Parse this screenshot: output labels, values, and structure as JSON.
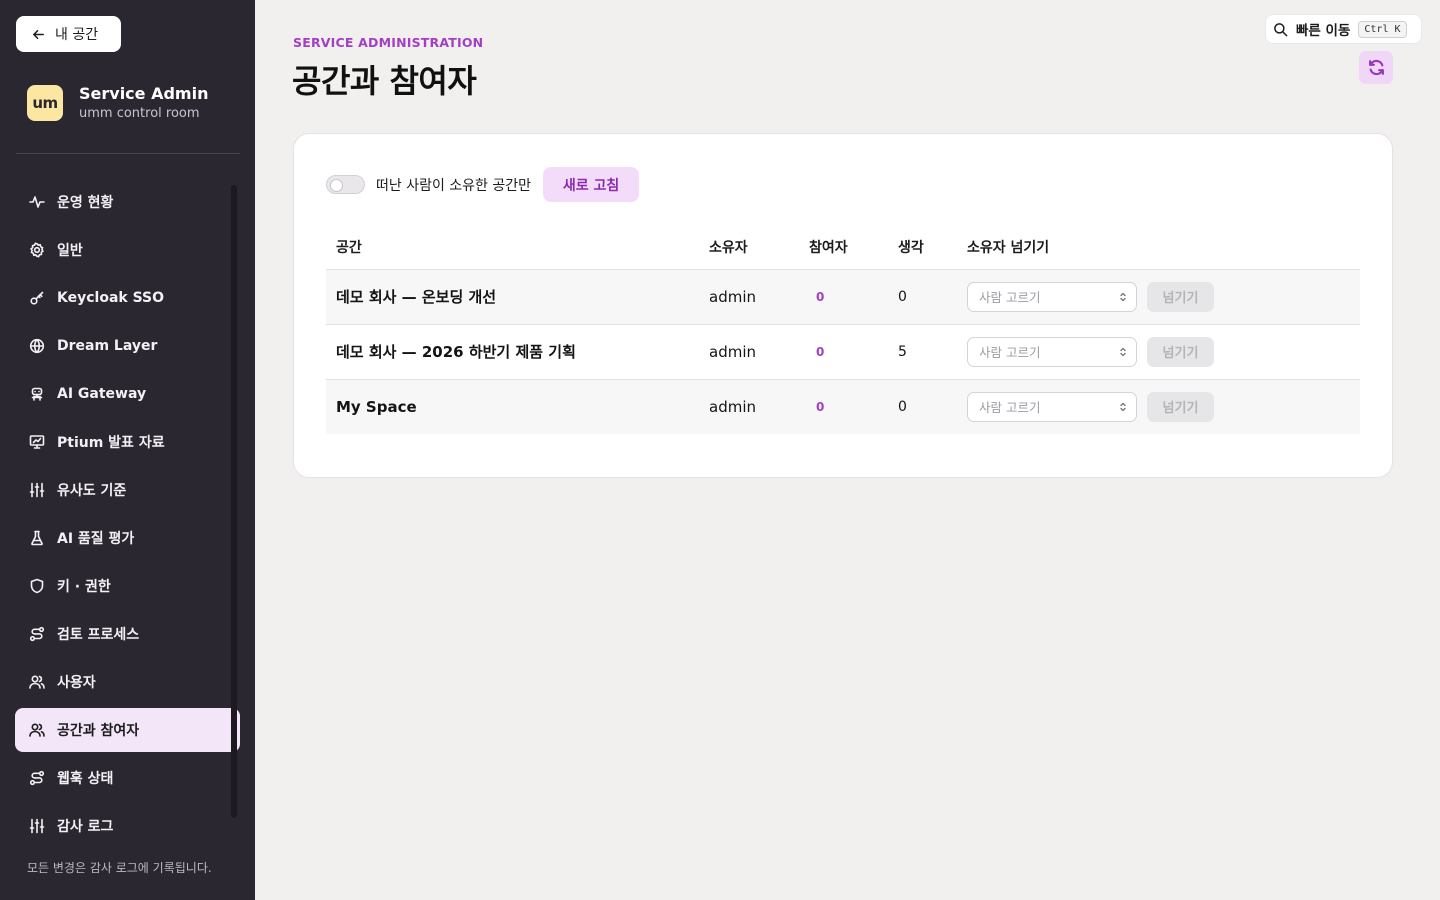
{
  "sidebar": {
    "back_label": "내 공간",
    "brand_logo": "um",
    "brand_title": "Service Admin",
    "brand_subtitle": "umm control room",
    "items": [
      {
        "label": "운영 현황",
        "icon": "activity-icon"
      },
      {
        "label": "일반",
        "icon": "gear-icon"
      },
      {
        "label": "Keycloak SSO",
        "icon": "key-icon"
      },
      {
        "label": "Dream Layer",
        "icon": "layers-icon"
      },
      {
        "label": "AI Gateway",
        "icon": "bot-icon"
      },
      {
        "label": "Ptium 발표 자료",
        "icon": "presentation-icon"
      },
      {
        "label": "유사도 기준",
        "icon": "sliders-icon"
      },
      {
        "label": "AI 품질 평가",
        "icon": "flask-icon"
      },
      {
        "label": "키 · 권한",
        "icon": "shield-icon"
      },
      {
        "label": "검토 프로세스",
        "icon": "route-icon"
      },
      {
        "label": "사용자",
        "icon": "users-icon"
      },
      {
        "label": "공간과 참여자",
        "icon": "users-icon",
        "active": true
      },
      {
        "label": "웹훅 상태",
        "icon": "route-icon"
      },
      {
        "label": "감사 로그",
        "icon": "sliders-icon"
      }
    ],
    "footer": "모든 변경은 감사 로그에 기록됩니다."
  },
  "header": {
    "eyebrow": "SERVICE ADMINISTRATION",
    "title": "공간과 참여자",
    "quick_nav_label": "빠른 이동",
    "quick_nav_shortcut": "Ctrl K"
  },
  "toolbar": {
    "toggle_label": "떠난 사람이 소유한 공간만",
    "toggle_on": false,
    "refresh_label": "새로 고침"
  },
  "table": {
    "columns": [
      "공간",
      "소유자",
      "참여자",
      "생각",
      "소유자 넘기기"
    ],
    "rows": [
      {
        "space": "데모 회사 — 온보딩 개선",
        "owner": "admin",
        "participants": "0",
        "thoughts": "0",
        "select_placeholder": "사람 고르기",
        "action": "넘기기"
      },
      {
        "space": "데모 회사 — 2026 하반기 제품 기획",
        "owner": "admin",
        "participants": "0",
        "thoughts": "5",
        "select_placeholder": "사람 고르기",
        "action": "넘기기"
      },
      {
        "space": "My Space",
        "owner": "admin",
        "participants": "0",
        "thoughts": "0",
        "select_placeholder": "사람 고르기",
        "action": "넘기기"
      }
    ]
  },
  "colors": {
    "accent": "#a43fc4",
    "sidebar_bg": "#2a2730",
    "active_item_bg": "#f3e6f8",
    "logo_bg": "#fbe7a1"
  }
}
